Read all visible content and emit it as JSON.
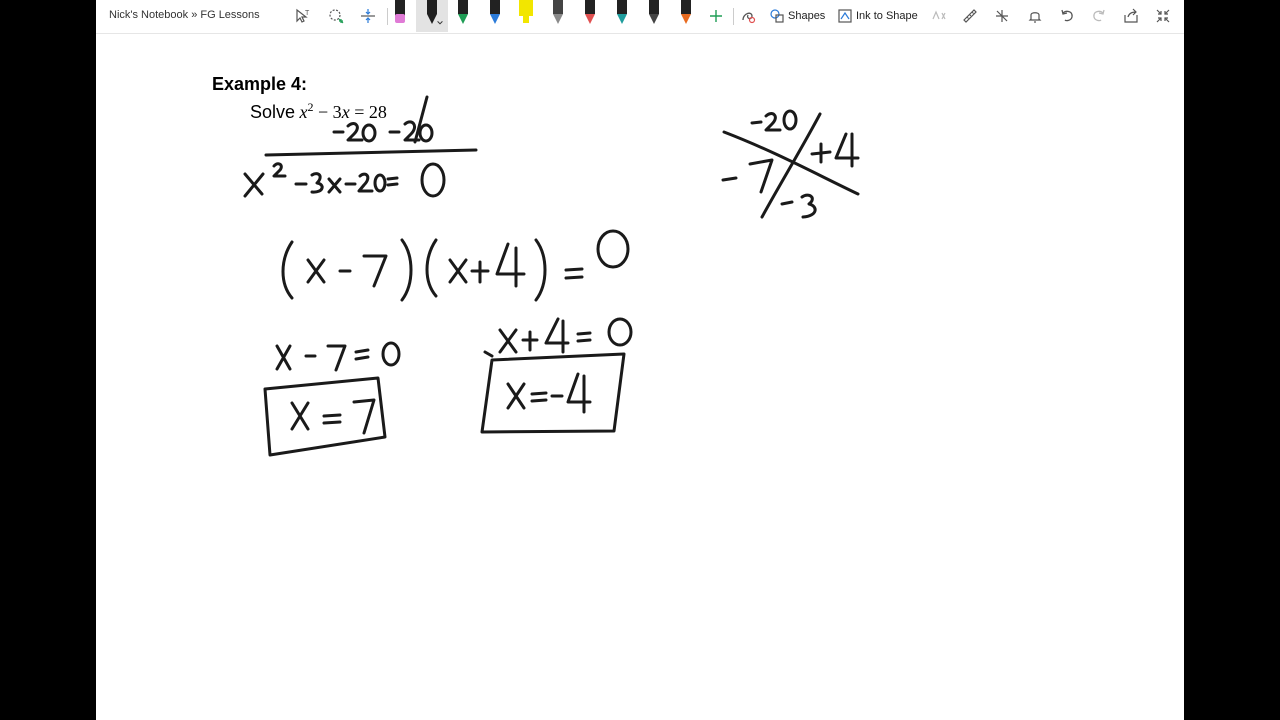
{
  "breadcrumb": "Nick's Notebook » FG Lessons",
  "toolbar": {
    "shapes_label": "Shapes",
    "ink_to_shape_label": "Ink to Shape",
    "pen_colors": [
      "#e07bd6",
      "#1f1f1f",
      "#1f9d55",
      "#2b7bd9",
      "#f2e600",
      "#8a8a8a",
      "#e05050",
      "#1f9d9d",
      "#444444",
      "#e86a1f"
    ]
  },
  "page": {
    "example_title": "Example 4:",
    "problem_word": "Solve",
    "problem_x": "x",
    "problem_exp": "2",
    "problem_rest": " − 3",
    "problem_x2": "x",
    "problem_end": " = 28"
  }
}
